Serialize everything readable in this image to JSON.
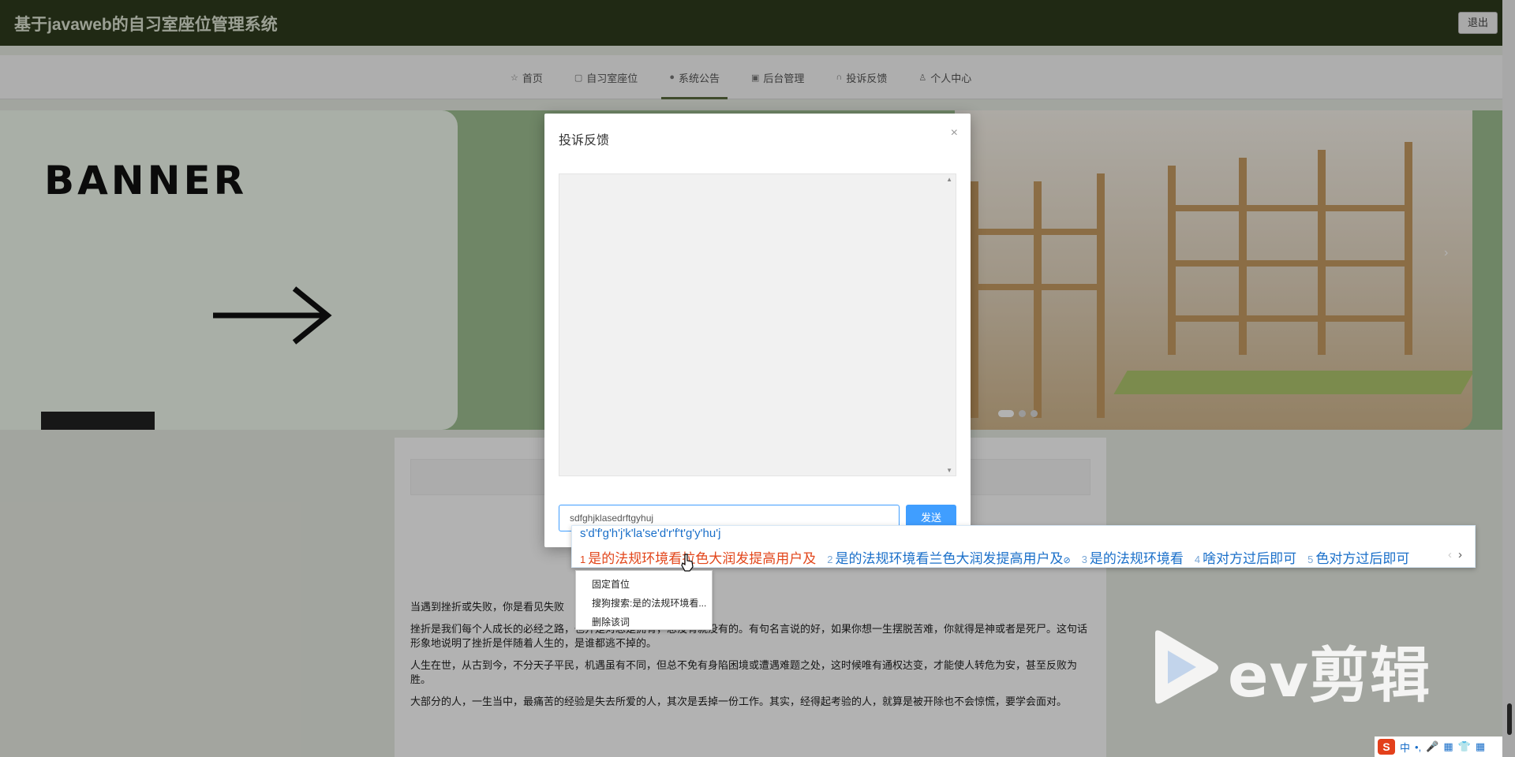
{
  "header": {
    "title": "基于javaweb的自习室座位管理系统",
    "logout_label": "退出"
  },
  "nav": {
    "items": [
      {
        "icon": "star-icon",
        "label": "首页",
        "active": false
      },
      {
        "icon": "seat-icon",
        "label": "自习室座位",
        "active": false
      },
      {
        "icon": "notice-icon",
        "label": "系统公告",
        "active": true
      },
      {
        "icon": "admin-icon",
        "label": "后台管理",
        "active": false
      },
      {
        "icon": "headset-icon",
        "label": "投诉反馈",
        "active": false
      },
      {
        "icon": "user-icon",
        "label": "个人中心",
        "active": false
      }
    ]
  },
  "banner": {
    "text": "BANNER",
    "next_symbol": "›",
    "slide_count": 3,
    "active_slide": 1
  },
  "article": {
    "paragraphs": [
      "当遇到挫折或失败，你是看见失败",
      "挫折是我们每个人成长的必经之路，也并是对总是拥有，总没有就没有的。有句名言说的好，如果你想一生摆脱苦难，你就得是神或者是死尸。这句话形象地说明了挫折是伴随着人生的，是谁都逃不掉的。",
      "人生在世，从古到今，不分天子平民，机遇虽有不同，但总不免有身陷困境或遭遇难题之处，这时候唯有通权达变，才能使人转危为安，甚至反败为胜。",
      "大部分的人，一生当中，最痛苦的经验是失去所爱的人，其次是丢掉一份工作。其实，经得起考验的人，就算是被开除也不会惊慌，要学会面对。"
    ]
  },
  "modal": {
    "title": "投诉反馈",
    "close_symbol": "×",
    "input_value": "sdfghjklasedrftgyhuj",
    "send_label": "发送"
  },
  "ime": {
    "pinyin": "s'd'f'g'h'j'k'la'se'd'r'f't'g'y'hu'j",
    "candidates": [
      {
        "num": "1",
        "text": "是的法规环境看拉色大润发提高用户及",
        "selected": true
      },
      {
        "num": "2",
        "text": "是的法规环境看兰色大润发提高用户及",
        "selected": false,
        "mark": "⊘"
      },
      {
        "num": "3",
        "text": "是的法规环境看",
        "selected": false
      },
      {
        "num": "4",
        "text": "啥对方过后即可",
        "selected": false
      },
      {
        "num": "5",
        "text": "色对方过后即可",
        "selected": false
      }
    ],
    "prev_symbol": "‹",
    "next_symbol": "›"
  },
  "context_menu": {
    "items": [
      "固定首位",
      "搜狗搜索:是的法规环境看...",
      "删除该词"
    ]
  },
  "watermark": {
    "text": "ev剪辑"
  },
  "tray": {
    "logo": "S",
    "items": [
      "中",
      "•,",
      "🎤",
      "▦",
      "👕",
      "▦"
    ]
  },
  "colors": {
    "header_bg": "#2f3b1d",
    "primary": "#409eff",
    "ime_selected": "#e2461b",
    "ime_text": "#1a6fc9"
  }
}
